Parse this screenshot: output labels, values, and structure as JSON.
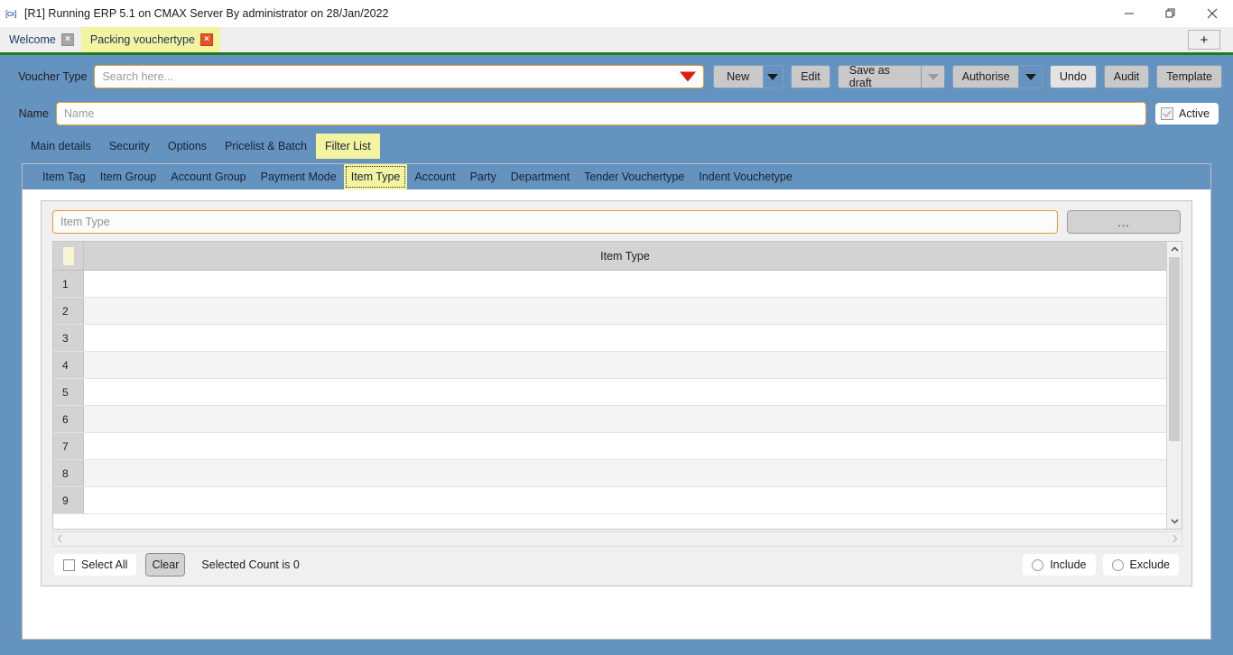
{
  "window": {
    "title": "[R1] Running ERP 5.1 on CMAX Server By administrator on 28/Jan/2022",
    "app_glyph": "[cx]",
    "minimize_label": "Minimize",
    "restore_label": "Restore",
    "close_label": "Close"
  },
  "tabstrip": {
    "tabs": [
      {
        "label": "Welcome",
        "active": false,
        "close": "×"
      },
      {
        "label": "Packing vouchertype",
        "active": true,
        "close": "×"
      }
    ],
    "new_tab_label": "+"
  },
  "toolbar": {
    "voucher_type_label": "Voucher Type",
    "search_placeholder": "Search here...",
    "search_value": "",
    "buttons": {
      "new": "New",
      "edit": "Edit",
      "save_as_draft": "Save as draft",
      "authorise": "Authorise",
      "undo": "Undo",
      "audit": "Audit",
      "template": "Template"
    },
    "name_label": "Name",
    "name_placeholder": "Name",
    "name_value": "",
    "active_label": "Active",
    "active_checked": true
  },
  "main_tabs": [
    {
      "label": "Main details",
      "active": false
    },
    {
      "label": "Security",
      "active": false
    },
    {
      "label": "Options",
      "active": false
    },
    {
      "label": "Pricelist & Batch",
      "active": false
    },
    {
      "label": "Filter List",
      "active": true
    }
  ],
  "sub_tabs": [
    {
      "label": "Item Tag",
      "active": false
    },
    {
      "label": "Item Group",
      "active": false
    },
    {
      "label": "Account Group",
      "active": false
    },
    {
      "label": "Payment Mode",
      "active": false
    },
    {
      "label": "Item Type",
      "active": true
    },
    {
      "label": "Account",
      "active": false
    },
    {
      "label": "Party",
      "active": false
    },
    {
      "label": "Department",
      "active": false
    },
    {
      "label": "Tender Vouchertype",
      "active": false
    },
    {
      "label": "Indent Vouchetype",
      "active": false
    }
  ],
  "filter_panel": {
    "search_placeholder": "Item Type",
    "search_value": "",
    "browse_label": "...",
    "grid": {
      "column_header": "Item Type",
      "rows": [
        {
          "num": "1",
          "value": ""
        },
        {
          "num": "2",
          "value": ""
        },
        {
          "num": "3",
          "value": ""
        },
        {
          "num": "4",
          "value": ""
        },
        {
          "num": "5",
          "value": ""
        },
        {
          "num": "6",
          "value": ""
        },
        {
          "num": "7",
          "value": ""
        },
        {
          "num": "8",
          "value": ""
        },
        {
          "num": "9",
          "value": ""
        }
      ]
    },
    "select_all_label": "Select All",
    "select_all_checked": false,
    "clear_label": "Clear",
    "selected_count_text": "Selected Count is 0",
    "include_label": "Include",
    "include_selected": false,
    "exclude_label": "Exclude",
    "exclude_selected": false
  },
  "colors": {
    "body_blue": "#6593c0",
    "active_tab_yellow": "#f3f3a0",
    "accent_orange": "#e79c2e",
    "green_rule": "#1f7a1f",
    "red_caret": "#e01b10"
  }
}
